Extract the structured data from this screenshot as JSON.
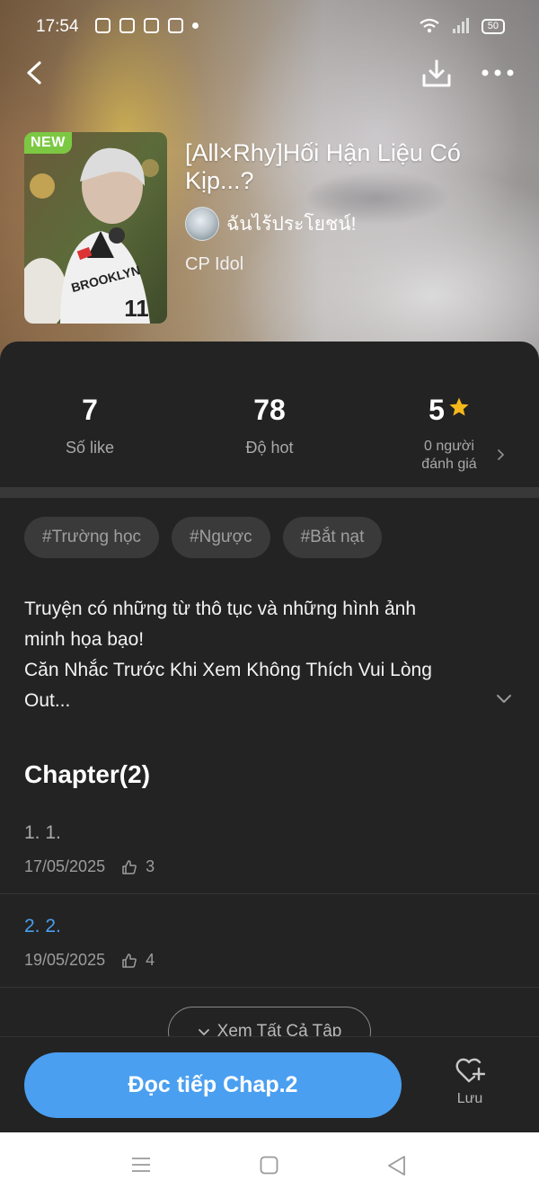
{
  "status_bar": {
    "time": "17:54",
    "battery": "50"
  },
  "story": {
    "badge": "NEW",
    "title": "[All×Rhy]Hối Hận Liệu Có Kịp...?",
    "author": "ฉันไร้ประโยชน์!",
    "category": "CP Idol",
    "cover_jersey_text": "BROOKLYN",
    "cover_jersey_number": "11"
  },
  "stats": {
    "likes": {
      "value": "7",
      "label": "Số like"
    },
    "hot": {
      "value": "78",
      "label": "Độ hot"
    },
    "rating": {
      "value": "5",
      "label_line1": "0 người",
      "label_line2": "đánh giá"
    }
  },
  "tags": [
    "#Trường học",
    "#Ngược",
    "#Bắt nạt"
  ],
  "description": {
    "line1": "Truyện có những từ thô tục và những hình ảnh",
    "line2": "minh họa bạo!",
    "line3": "Căn Nhắc Trước Khi Xem Không Thích Vui Lòng",
    "line4": "Out..."
  },
  "chapters": {
    "heading": "Chapter(2)",
    "items": [
      {
        "title": "1. 1.",
        "date": "17/05/2025",
        "likes": "3",
        "color": "#a8a8a8"
      },
      {
        "title": "2. 2.",
        "date": "19/05/2025",
        "likes": "4",
        "color": "#4a9ff0"
      }
    ],
    "view_all": "Xem Tất Cả Tập"
  },
  "actions": {
    "read_label": "Đọc tiếp Chap.2",
    "save_label": "Lưu"
  },
  "colors": {
    "accent": "#4a9ff0",
    "badge_new": "#7cc843",
    "star": "#f5b81c",
    "panel": "#232323"
  }
}
